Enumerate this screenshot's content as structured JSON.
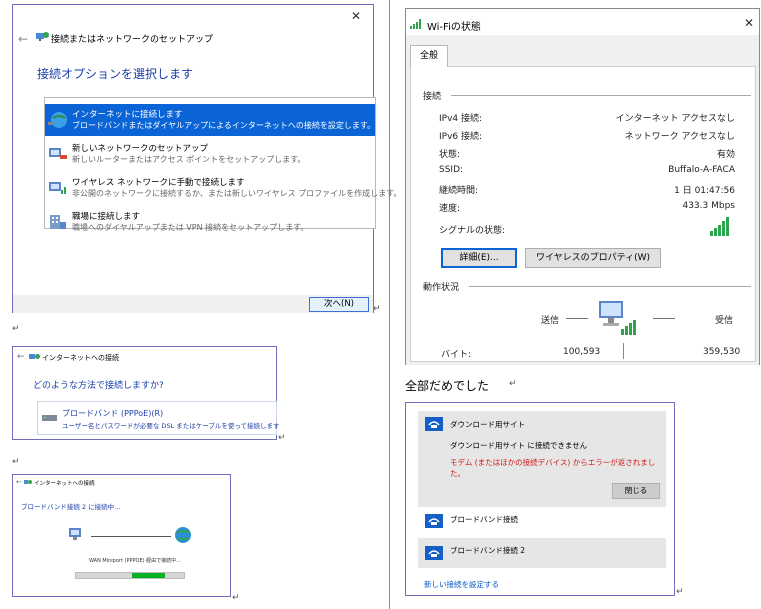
{
  "panel1": {
    "title": "接続またはネットワークのセットアップ",
    "heading": "接続オプションを選択します",
    "options": [
      {
        "title": "インターネットに接続します",
        "desc": "ブロードバンドまたはダイヤルアップによるインターネットへの接続を設定します。"
      },
      {
        "title": "新しいネットワークのセットアップ",
        "desc": "新しいルーターまたはアクセス ポイントをセットアップします。"
      },
      {
        "title": "ワイヤレス ネットワークに手動で接続します",
        "desc": "非公開のネットワークに接続するか、または新しいワイヤレス プロファイルを作成します。"
      },
      {
        "title": "職場に接続します",
        "desc": "職場へのダイヤルアップまたは VPN 接続をセットアップします。"
      }
    ],
    "next_label": "次へ(N)"
  },
  "panel2": {
    "title": "インターネットへの接続",
    "heading": "どのような方法で接続しますか?",
    "option_title": "ブロードバンド (PPPoE)(R)",
    "option_desc": "ユーザー名とパスワードが必要な DSL またはケーブルを使って接続します"
  },
  "panel3": {
    "title": "インターネットへの接続",
    "heading": "ブロードバンド接続 2 に接続中...",
    "status": "WAN Miniport (PPPOE) 経由で接続中...",
    "progress_start": 0.82,
    "progress_width": 0.3
  },
  "wifi": {
    "title": "Wi-Fiの状態",
    "tab": "全般",
    "section_connection": "接続",
    "rows": [
      {
        "label": "IPv4 接続:",
        "value": "インターネット アクセスなし"
      },
      {
        "label": "IPv6 接続:",
        "value": "ネットワーク アクセスなし"
      },
      {
        "label": "状態:",
        "value": "有効"
      },
      {
        "label": "SSID:",
        "value": "Buffalo-A-FACA"
      },
      {
        "label": "継続時間:",
        "value": "1 日 01:47:56"
      },
      {
        "label": "速度:",
        "value": "433.3 Mbps"
      }
    ],
    "signal_label": "シグナルの状態:",
    "details_button": "詳細(E)...",
    "wireless_button": "ワイヤレスのプロパティ(W)",
    "section_activity": "動作状況",
    "sent_label": "送信",
    "received_label": "受信",
    "bytes_label": "バイト:",
    "bytes_sent": "100,593",
    "bytes_received": "359,530"
  },
  "caption": "全部だめでした",
  "dialup": {
    "item1_name": "ダウンロード用サイト",
    "item1_msg": "ダウンロード用サイト に接続できません",
    "item1_error": "モデム (またはほかの接続デバイス) からエラーが返されました。",
    "close_button": "閉じる",
    "item2_name": "ブロードバンド接続",
    "item3_name": "ブロードバンド接続 2",
    "new_link": "新しい接続を設定する"
  }
}
